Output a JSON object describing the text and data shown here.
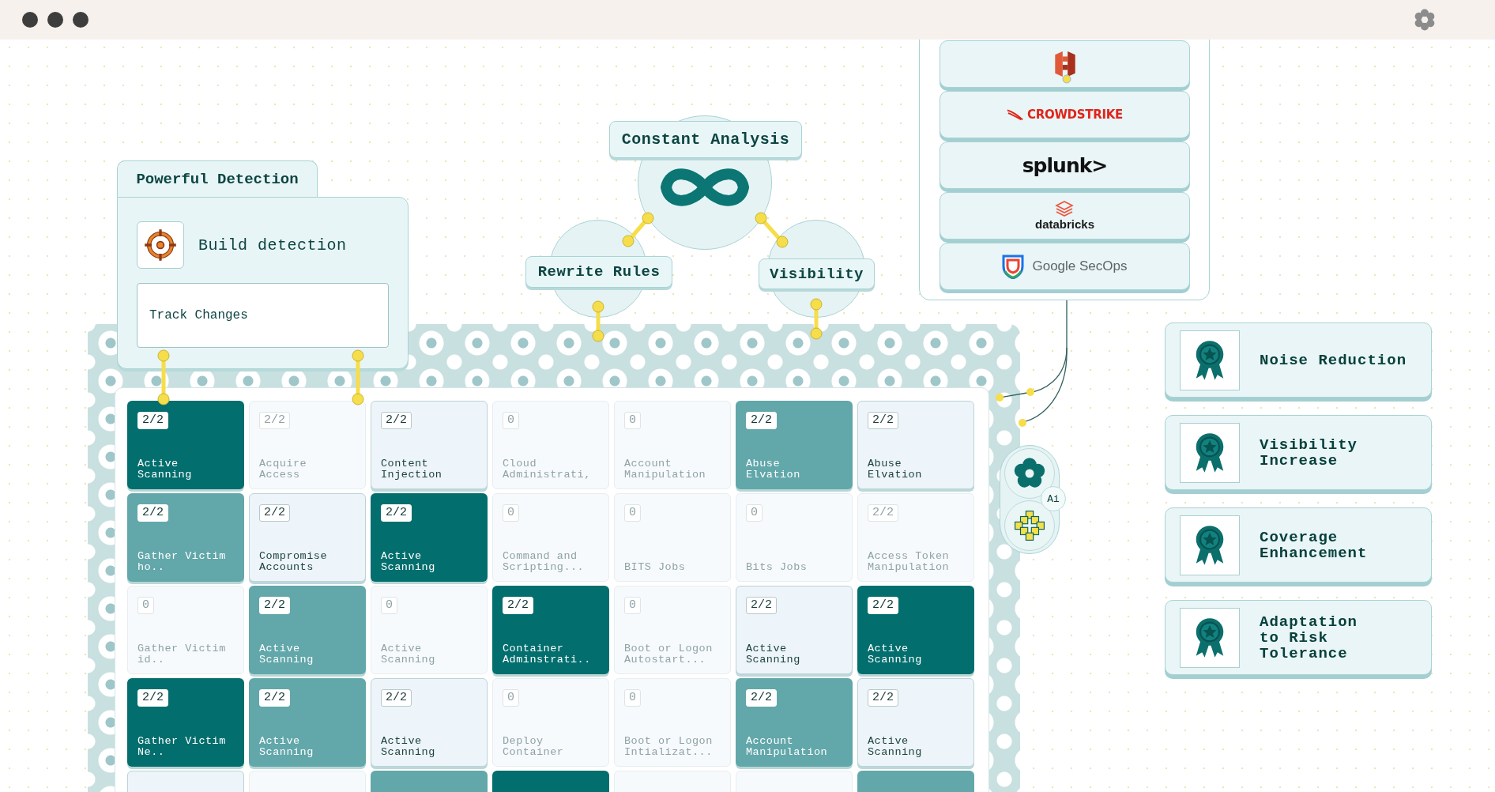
{
  "detection": {
    "title": "Powerful Detection",
    "action": "Build detection",
    "field_value": "Track Changes"
  },
  "analysis": {
    "title": "Constant Analysis",
    "branches": [
      "Rewrite Rules",
      "Visibility"
    ]
  },
  "integrations": [
    {
      "kind": "aws"
    },
    {
      "kind": "crowdstrike",
      "label": "CROWDSTRIKE"
    },
    {
      "kind": "splunk",
      "label": "splunk>"
    },
    {
      "kind": "databricks",
      "label": "databricks"
    },
    {
      "kind": "secops",
      "label": "Google SecOps"
    }
  ],
  "ai_badge": "Ai",
  "outcomes": [
    "Noise Reduction",
    "Visibility\nIncrease",
    "Coverage\nEnhancement",
    "Adaptation\nto Risk\nTolerance"
  ],
  "grid": [
    [
      {
        "kind": "dark",
        "badge": "2/2",
        "label": "Active Scanning"
      },
      {
        "kind": "inactive",
        "badge": "2/2",
        "label": "Acquire Access"
      },
      {
        "kind": "light",
        "badge": "2/2",
        "label": "Content Injection"
      },
      {
        "kind": "inactive",
        "badge": "0",
        "label": "Cloud Administrati,"
      },
      {
        "kind": "inactive",
        "badge": "0",
        "label": "Account Manipulation"
      },
      {
        "kind": "medium",
        "badge": "2/2",
        "label": "Abuse Elvation"
      },
      {
        "kind": "light",
        "badge": "2/2",
        "label": "Abuse Elvation"
      }
    ],
    [
      {
        "kind": "medium",
        "badge": "2/2",
        "label": "Gather Victim ho.."
      },
      {
        "kind": "light",
        "badge": "2/2",
        "label": "Compromise Accounts"
      },
      {
        "kind": "dark",
        "badge": "2/2",
        "label": "Active Scanning"
      },
      {
        "kind": "inactive",
        "badge": "0",
        "label": "Command and Scripting..."
      },
      {
        "kind": "inactive",
        "badge": "0",
        "label": "BITS Jobs"
      },
      {
        "kind": "inactive",
        "badge": "0",
        "label": "Bits Jobs"
      },
      {
        "kind": "inactive",
        "badge": "2/2",
        "label": "Access Token Manipulation"
      }
    ],
    [
      {
        "kind": "inactive",
        "badge": "0",
        "label": "Gather Victim id.."
      },
      {
        "kind": "medium",
        "badge": "2/2",
        "label": "Active Scanning"
      },
      {
        "kind": "inactive",
        "badge": "0",
        "label": "Active Scanning"
      },
      {
        "kind": "dark",
        "badge": "2/2",
        "label": "Container Adminstrati.."
      },
      {
        "kind": "inactive",
        "badge": "0",
        "label": "Boot or Logon Autostart..."
      },
      {
        "kind": "light",
        "badge": "2/2",
        "label": "Active Scanning"
      },
      {
        "kind": "dark",
        "badge": "2/2",
        "label": "Active Scanning"
      }
    ],
    [
      {
        "kind": "dark",
        "badge": "2/2",
        "label": "Gather Victim Ne.."
      },
      {
        "kind": "medium",
        "badge": "2/2",
        "label": "Active Scanning"
      },
      {
        "kind": "light",
        "badge": "2/2",
        "label": "Active Scanning"
      },
      {
        "kind": "inactive",
        "badge": "0",
        "label": "Deploy Container"
      },
      {
        "kind": "inactive",
        "badge": "0",
        "label": "Boot or Logon Intializat..."
      },
      {
        "kind": "medium",
        "badge": "2/2",
        "label": "Account Manipulation"
      },
      {
        "kind": "light",
        "badge": "2/2",
        "label": "Active Scanning"
      }
    ],
    [
      {
        "kind": "light"
      },
      {
        "kind": "inactive"
      },
      {
        "kind": "medium"
      },
      {
        "kind": "dark"
      },
      {
        "kind": "inactive"
      },
      {
        "kind": "inactive"
      },
      {
        "kind": "medium"
      }
    ]
  ]
}
